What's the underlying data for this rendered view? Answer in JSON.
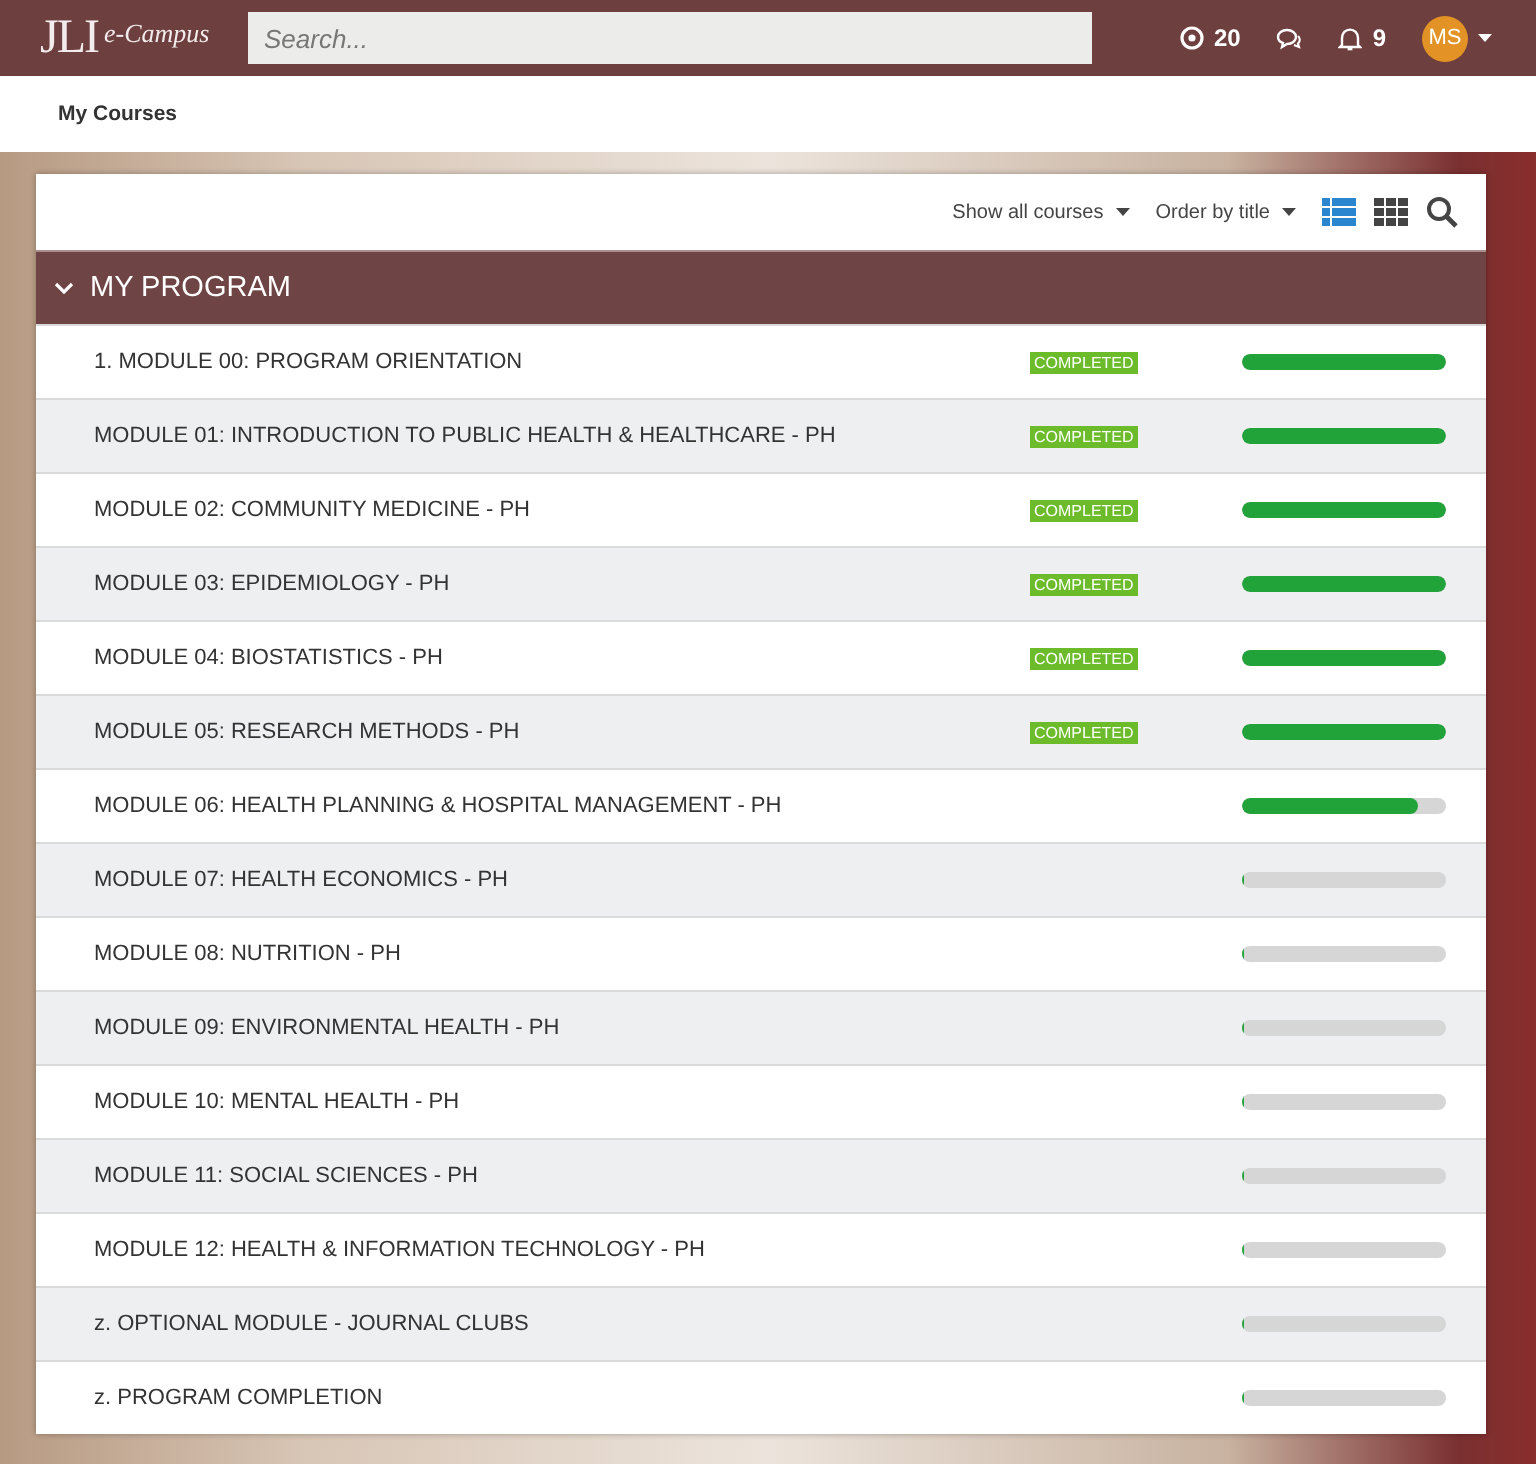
{
  "header": {
    "logo_main": "JLI",
    "logo_sub": "e-Campus",
    "search": {
      "placeholder": "Search..."
    },
    "points": "20",
    "notifications": "9",
    "avatar": "MS"
  },
  "breadcrumb": "My Courses",
  "toolbar": {
    "filter": "Show all courses",
    "order": "Order by title",
    "views": [
      {
        "kind": "list",
        "selected": true
      },
      {
        "kind": "grid",
        "selected": false
      }
    ]
  },
  "program": {
    "title": "MY PROGRAM",
    "expanded": true,
    "courses": [
      {
        "title": "1. MODULE 00: PROGRAM ORIENTATION",
        "badge": "COMPLETED",
        "level": 1
      },
      {
        "title": "MODULE 01: INTRODUCTION TO PUBLIC HEALTH & HEALTHCARE - PH",
        "badge": "COMPLETED",
        "level": 1
      },
      {
        "title": "MODULE 02: COMMUNITY MEDICINE - PH",
        "badge": "COMPLETED",
        "level": 1
      },
      {
        "title": "MODULE 03: EPIDEMIOLOGY - PH",
        "badge": "COMPLETED",
        "level": 1
      },
      {
        "title": "MODULE 04: BIOSTATISTICS - PH",
        "badge": "COMPLETED",
        "level": 1
      },
      {
        "title": "MODULE 05: RESEARCH METHODS - PH",
        "badge": "COMPLETED",
        "level": 1
      },
      {
        "title": "MODULE 06: HEALTH PLANNING & HOSPITAL MANAGEMENT - PH",
        "level": 0.86
      },
      {
        "title": "MODULE 07: HEALTH ECONOMICS - PH",
        "level": 0
      },
      {
        "title": "MODULE 08: NUTRITION - PH",
        "level": 0
      },
      {
        "title": "MODULE 09: ENVIRONMENTAL HEALTH - PH",
        "level": 0
      },
      {
        "title": "MODULE 10: MENTAL HEALTH - PH",
        "level": 0
      },
      {
        "title": "MODULE 11: SOCIAL SCIENCES - PH",
        "level": 0
      },
      {
        "title": "MODULE 12: HEALTH & INFORMATION TECHNOLOGY - PH",
        "level": 0
      },
      {
        "title": "z. OPTIONAL MODULE - JOURNAL CLUBS",
        "level": 0
      },
      {
        "title": "z. PROGRAM COMPLETION",
        "level": 0
      }
    ]
  }
}
